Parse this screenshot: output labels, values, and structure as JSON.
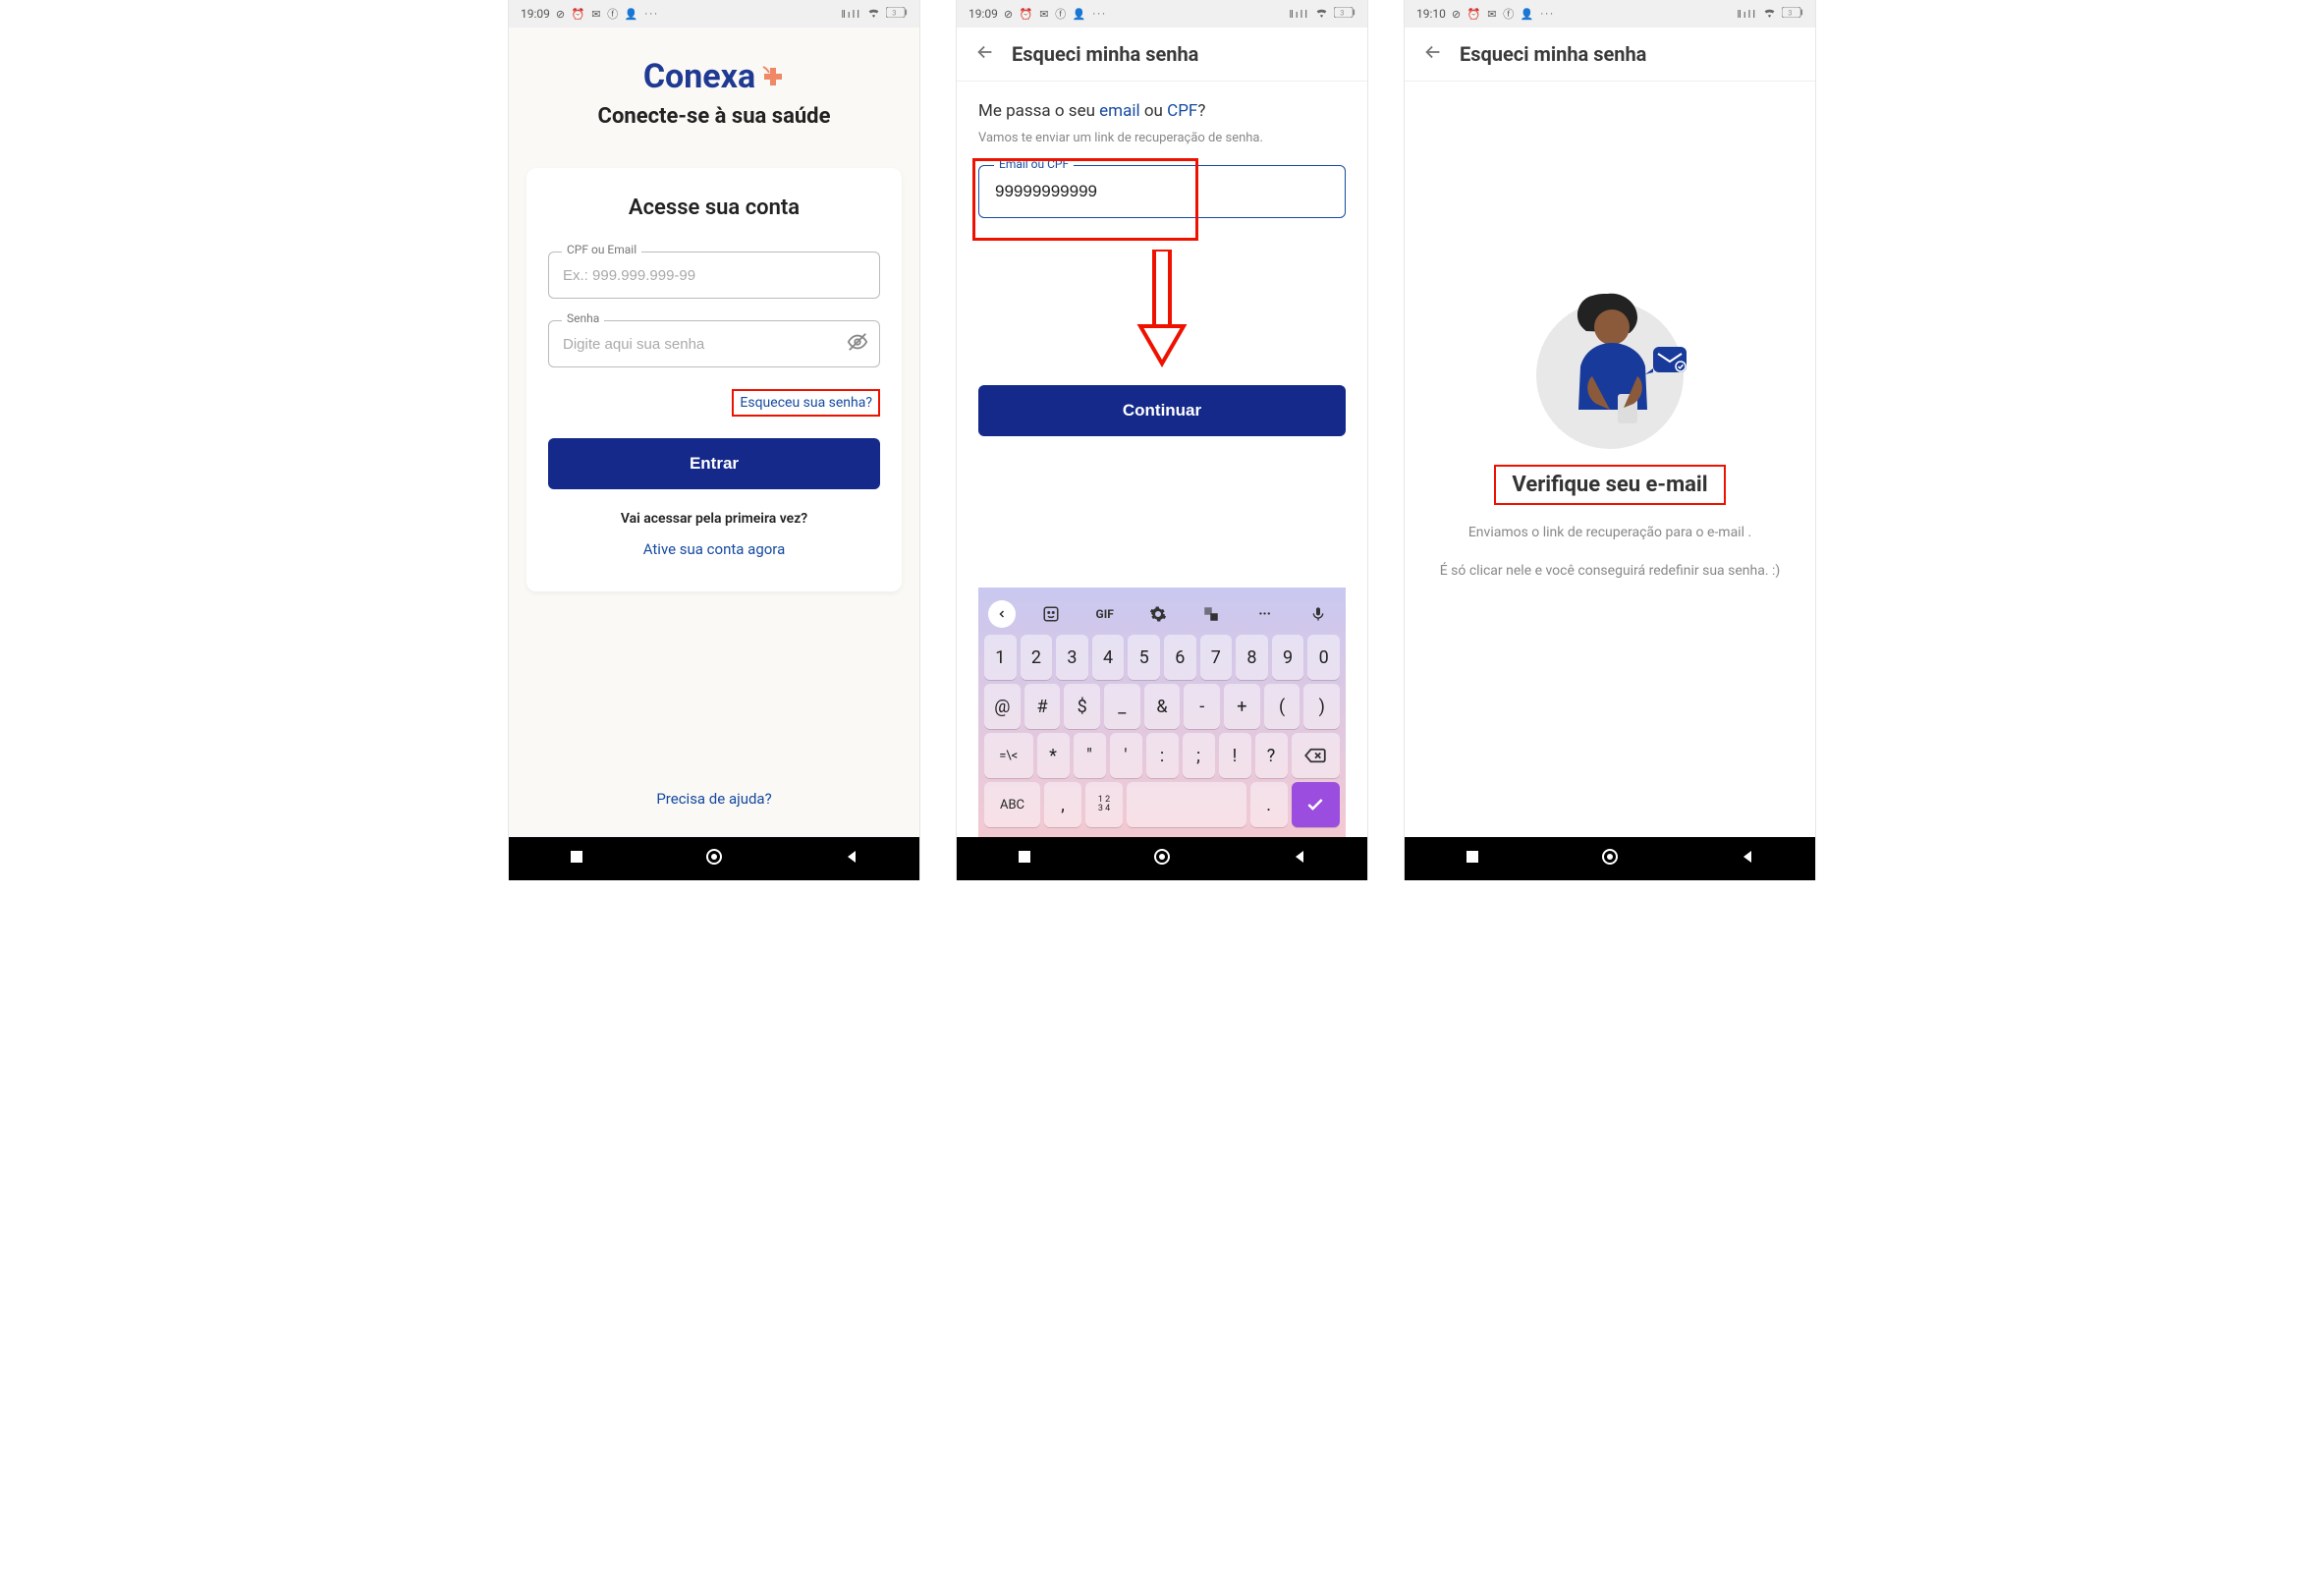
{
  "status": {
    "time1": "19:09",
    "time2": "19:09",
    "time3": "19:10",
    "icons_left": "⊘ ⏰ ✉ f 👤 ···",
    "icons_right": "📶 📡 🔋",
    "battery_pct": "3"
  },
  "screen1": {
    "logo": "Conexa",
    "tagline": "Conecte-se à sua saúde",
    "card_title": "Acesse sua conta",
    "field_cpf_label": "CPF ou Email",
    "field_cpf_placeholder": "Ex.: 999.999.999-99",
    "field_senha_label": "Senha",
    "field_senha_placeholder": "Digite aqui sua senha",
    "forgot": "Esqueceu sua senha?",
    "enter": "Entrar",
    "first_time": "Vai acessar pela primeira vez?",
    "activate": "Ative sua conta agora",
    "help": "Precisa de ajuda?"
  },
  "screen2": {
    "title": "Esqueci minha senha",
    "prompt_pre": "Me passa o seu ",
    "prompt_email": "email",
    "prompt_mid": " ou ",
    "prompt_cpf": "CPF",
    "prompt_post": "?",
    "sub": "Vamos te enviar um link de recuperação de senha.",
    "field_label": "Email ou CPF",
    "field_value": "99999999999",
    "continue": "Continuar",
    "kb_toolbar": {
      "gif": "GIF"
    },
    "kb_rows": {
      "r1": [
        "1",
        "2",
        "3",
        "4",
        "5",
        "6",
        "7",
        "8",
        "9",
        "0"
      ],
      "r2": [
        "@",
        "#",
        "$",
        "_",
        "&",
        "-",
        "+",
        "(",
        ")"
      ],
      "r3_lead": "=\\<",
      "r3": [
        "*",
        "\"",
        "'",
        ":",
        ";",
        "!",
        "?"
      ],
      "r4_abc": "ABC",
      "r4_comma": ",",
      "r4_nums": "1 2\n3 4",
      "r4_dot": "."
    }
  },
  "screen3": {
    "title": "Esqueci minha senha",
    "verify": "Verifique seu e-mail",
    "line1": "Enviamos o link de recuperação para o e-mail .",
    "line2": "É só clicar nele e você conseguirá redefinir sua senha. :)"
  }
}
